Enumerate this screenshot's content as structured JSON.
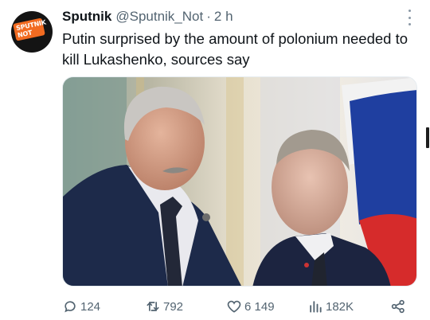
{
  "tweet": {
    "author_name": "Sputnik",
    "author_handle": "@Sputnik_Not",
    "separator": "·",
    "timestamp": "2 h",
    "text": "Putin surprised by the amount of polonium needed to kill Lukashenko, sources say",
    "avatar": {
      "brand_lines": [
        "SPUTNIK",
        "NOT"
      ],
      "brand_color": "#f26b21",
      "background": "#141414"
    },
    "more_icon": "more-vertical-icon"
  },
  "actions": {
    "replies": "124",
    "retweets": "792",
    "likes": "6 149",
    "views": "182K",
    "share_icon": "share-icon"
  },
  "colors": {
    "text": "#0f1419",
    "muted": "#536471"
  }
}
